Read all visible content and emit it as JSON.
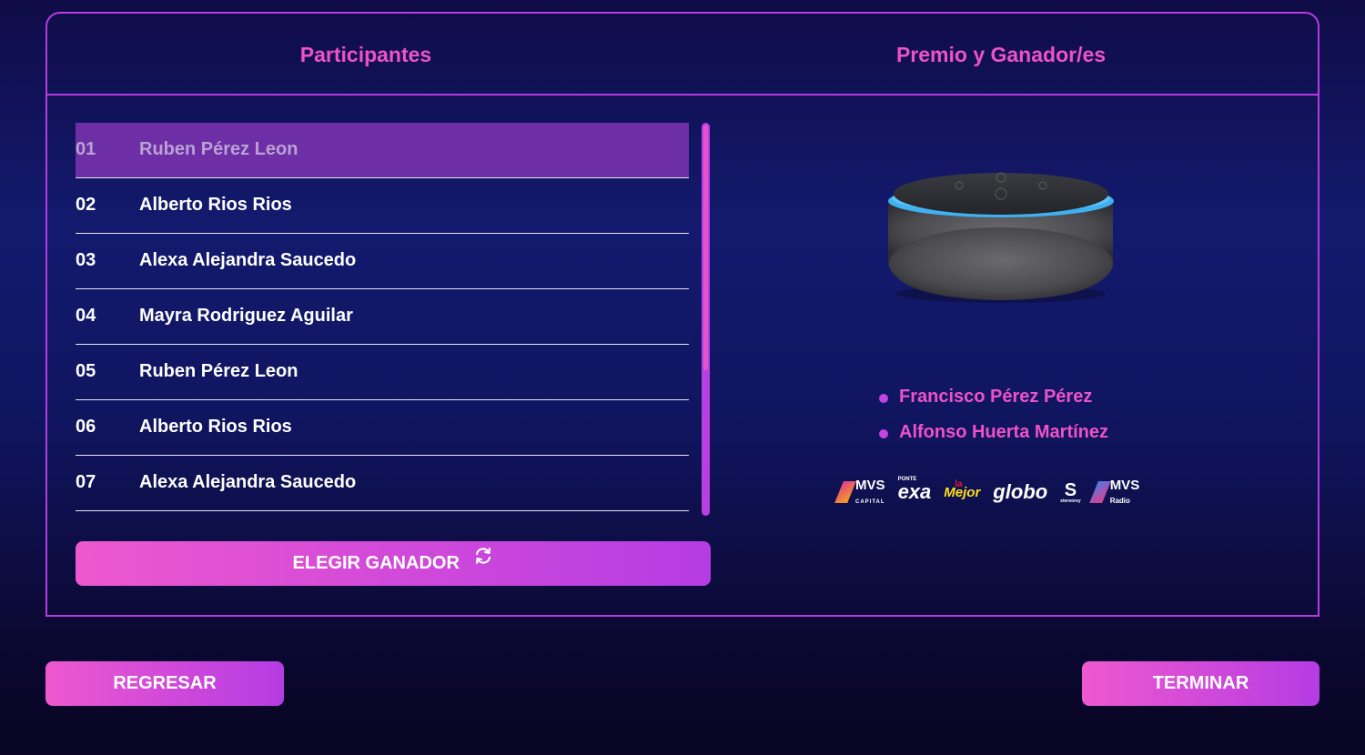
{
  "header": {
    "participants_title": "Participantes",
    "prize_title": "Premio y Ganador/es"
  },
  "participants": [
    {
      "num": "01",
      "name": "Ruben Pérez Leon"
    },
    {
      "num": "02",
      "name": "Alberto Rios Rios"
    },
    {
      "num": "03",
      "name": "Alexa Alejandra Saucedo"
    },
    {
      "num": "04",
      "name": "Mayra Rodriguez Aguilar"
    },
    {
      "num": "05",
      "name": "Ruben Pérez Leon"
    },
    {
      "num": "06",
      "name": "Alberto Rios Rios"
    },
    {
      "num": "07",
      "name": "Alexa Alejandra Saucedo"
    }
  ],
  "choose_winner_label": "ELEGIR GANADOR",
  "prize_image": "smart-speaker-image",
  "winners": [
    "Francisco Pérez Pérez",
    "Alfonso Huerta Martínez"
  ],
  "logos": {
    "mvs_capital": {
      "main": "MVS",
      "sub": "CAPITAL"
    },
    "exa": {
      "top": "PONTE",
      "main": "exa"
    },
    "la_mejor": {
      "top": "la",
      "main": "Mejor"
    },
    "globo": "globo",
    "stereorey": "stereorey",
    "mvs_radio": {
      "main": "MVS",
      "sub": "Radio"
    }
  },
  "footer": {
    "back_label": "REGRESAR",
    "finish_label": "TERMINAR"
  },
  "colors": {
    "accent_pink": "#ee52c8",
    "accent_purple": "#b63ae0",
    "active_row": "#6e2ea6"
  }
}
